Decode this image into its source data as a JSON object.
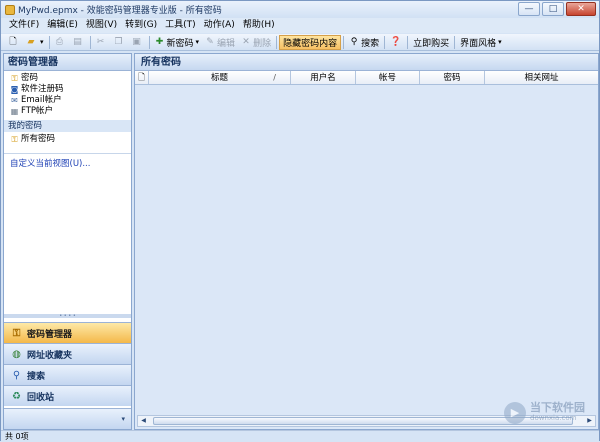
{
  "window": {
    "title": "MyPwd.epmx - 效能密码管理器专业版 - 所有密码",
    "min": "—",
    "max": "□",
    "close": "✕"
  },
  "menu": [
    "文件(F)",
    "编辑(E)",
    "视图(V)",
    "转到(G)",
    "工具(T)",
    "动作(A)",
    "帮助(H)"
  ],
  "toolbar": {
    "new_password": "新密码",
    "edit": "编辑",
    "delete": "删除",
    "hide_content": "隐藏密码内容",
    "search": "搜索",
    "buy_now": "立即购买",
    "theme": "界面风格"
  },
  "left_pane": {
    "title": "密码管理器",
    "categories": [
      {
        "label": "密码",
        "icon": "key-icon"
      },
      {
        "label": "软件注册码",
        "icon": "registration-icon"
      },
      {
        "label": "Email帐户",
        "icon": "email-icon"
      },
      {
        "label": "FTP帐户",
        "icon": "ftp-icon"
      }
    ],
    "my_passwords_label": "我的密码",
    "all_passwords": "所有密码",
    "custom_view": "自定义当前视图(U)..."
  },
  "nav": {
    "password_manager": "密码管理器",
    "bookmarks": "网址收藏夹",
    "search": "搜索",
    "recycle_bin": "回收站"
  },
  "right_pane": {
    "title": "所有密码",
    "columns": [
      "标题",
      "用户名",
      "帐号",
      "密码",
      "相关网址"
    ]
  },
  "status": {
    "count": "共 0项"
  },
  "watermark": {
    "line1": "当下软件园",
    "line2": "downxia.com"
  }
}
